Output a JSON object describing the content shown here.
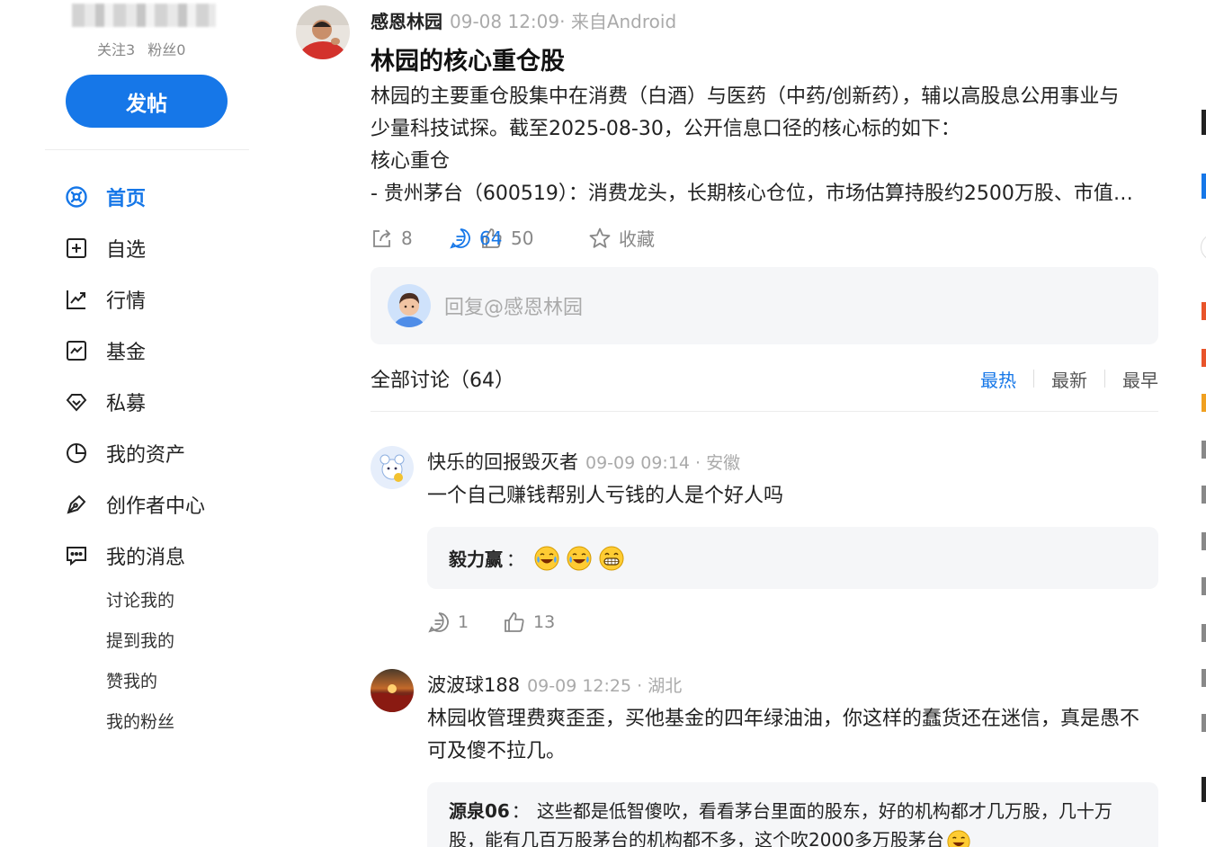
{
  "sidebar": {
    "follow_label": "关注3",
    "fans_label": "粉丝0",
    "post_button": "发帖",
    "nav": [
      {
        "label": "首页",
        "icon": "home-icon",
        "active": true
      },
      {
        "label": "自选",
        "icon": "plus-square-icon"
      },
      {
        "label": "行情",
        "icon": "trend-chart-icon"
      },
      {
        "label": "基金",
        "icon": "fund-chart-icon"
      },
      {
        "label": "私募",
        "icon": "diamond-icon"
      },
      {
        "label": "我的资产",
        "icon": "pie-chart-icon"
      },
      {
        "label": "创作者中心",
        "icon": "pen-icon"
      },
      {
        "label": "我的消息",
        "icon": "message-icon"
      }
    ],
    "messages_sub": [
      "讨论我的",
      "提到我的",
      "赞我的",
      "我的粉丝"
    ]
  },
  "post": {
    "author": "感恩林园",
    "time": "09-08 12:09· 来自Android",
    "title": "林园的核心重仓股",
    "body": [
      "林园的主要重仓股集中在消费（白酒）与医药（中药/创新药），辅以高股息公用事业与",
      "少量科技试探。截至2025-08-30，公开信息口径的核心标的如下：",
      "核心重仓",
      "- 贵州茅台（600519）：消费龙头，长期核心仓位，市场估算持股约2500万股、市值…"
    ],
    "actions": {
      "share": "8",
      "comments": "64",
      "likes": "50",
      "favorite": "收藏"
    }
  },
  "reply_box": {
    "placeholder": "回复@感恩林园"
  },
  "discussion": {
    "title": "全部讨论（64）",
    "sort": [
      "最热",
      "最新",
      "最早"
    ],
    "sort_active": "最热"
  },
  "comments": [
    {
      "author": "快乐的回报毁灭者",
      "time": "09-09 09:14 · 安徽",
      "text": "一个自己赚钱帮别人亏钱的人是个好人吗",
      "reply_author": "毅力赢",
      "reply_sep": "：",
      "reply_emojis": [
        "laughing-tears-emoji",
        "laughing-tears-emoji",
        "grin-emoji"
      ],
      "comment_count": "1",
      "like_count": "13"
    },
    {
      "author": "波波球188",
      "time": "09-09 12:25 · 湖北",
      "text_lines": [
        "林园收管理费爽歪歪，买他基金的四年绿油油，你这样的蠢货还在迷信，真是愚不",
        "可及傻不拉几。"
      ],
      "reply_author": "源泉06",
      "reply_sep": "：",
      "reply_text": "这些都是低智傻吹，看看茅台里面的股东，好的机构都才几万股，几十万",
      "reply_text_2": "股，能有几百万股茅台的机构都不多，这个吹2000多万股茅台"
    }
  ],
  "right_column": {
    "colors": {
      "accent": "#1677e8",
      "hot": "#e8542a",
      "orange": "#f0a020"
    }
  },
  "colors": {
    "accent": "#1677e8",
    "muted": "#aaaaaa",
    "panel": "#f5f6f8"
  }
}
